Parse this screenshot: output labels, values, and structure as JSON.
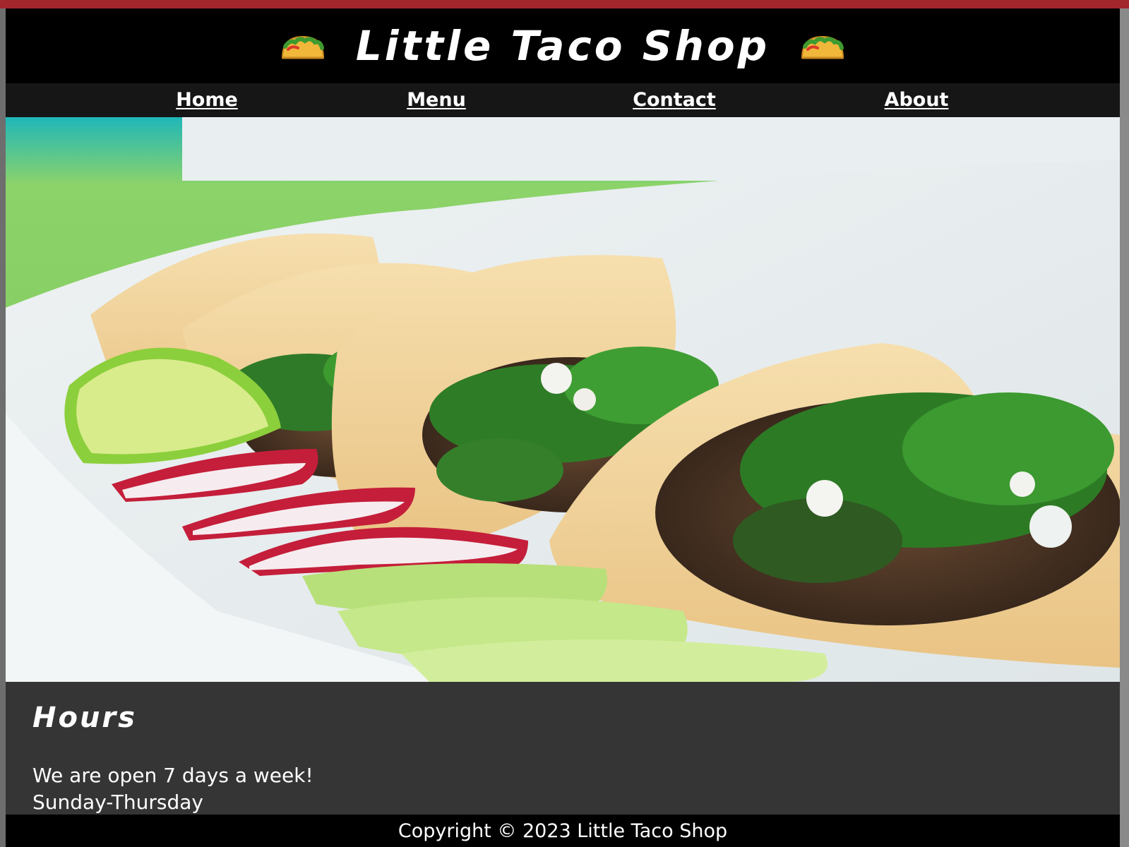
{
  "header": {
    "title": "Little Taco Shop",
    "left_icon": "taco-icon",
    "right_icon": "taco-icon"
  },
  "nav": {
    "items": [
      {
        "label": "Home"
      },
      {
        "label": "Menu"
      },
      {
        "label": "Contact"
      },
      {
        "label": "About"
      }
    ]
  },
  "hero": {
    "image": "tacos-photo"
  },
  "hours": {
    "heading": "Hours",
    "lines": [
      "We are open 7 days a week!",
      "Sunday-Thursday"
    ]
  },
  "footer": {
    "copyright": "Copyright © 2023 Little Taco Shop"
  },
  "colors": {
    "accent_strip": "#a3262c",
    "header_bg": "#000000",
    "nav_bg": "#161616",
    "section_bg": "#353535"
  }
}
